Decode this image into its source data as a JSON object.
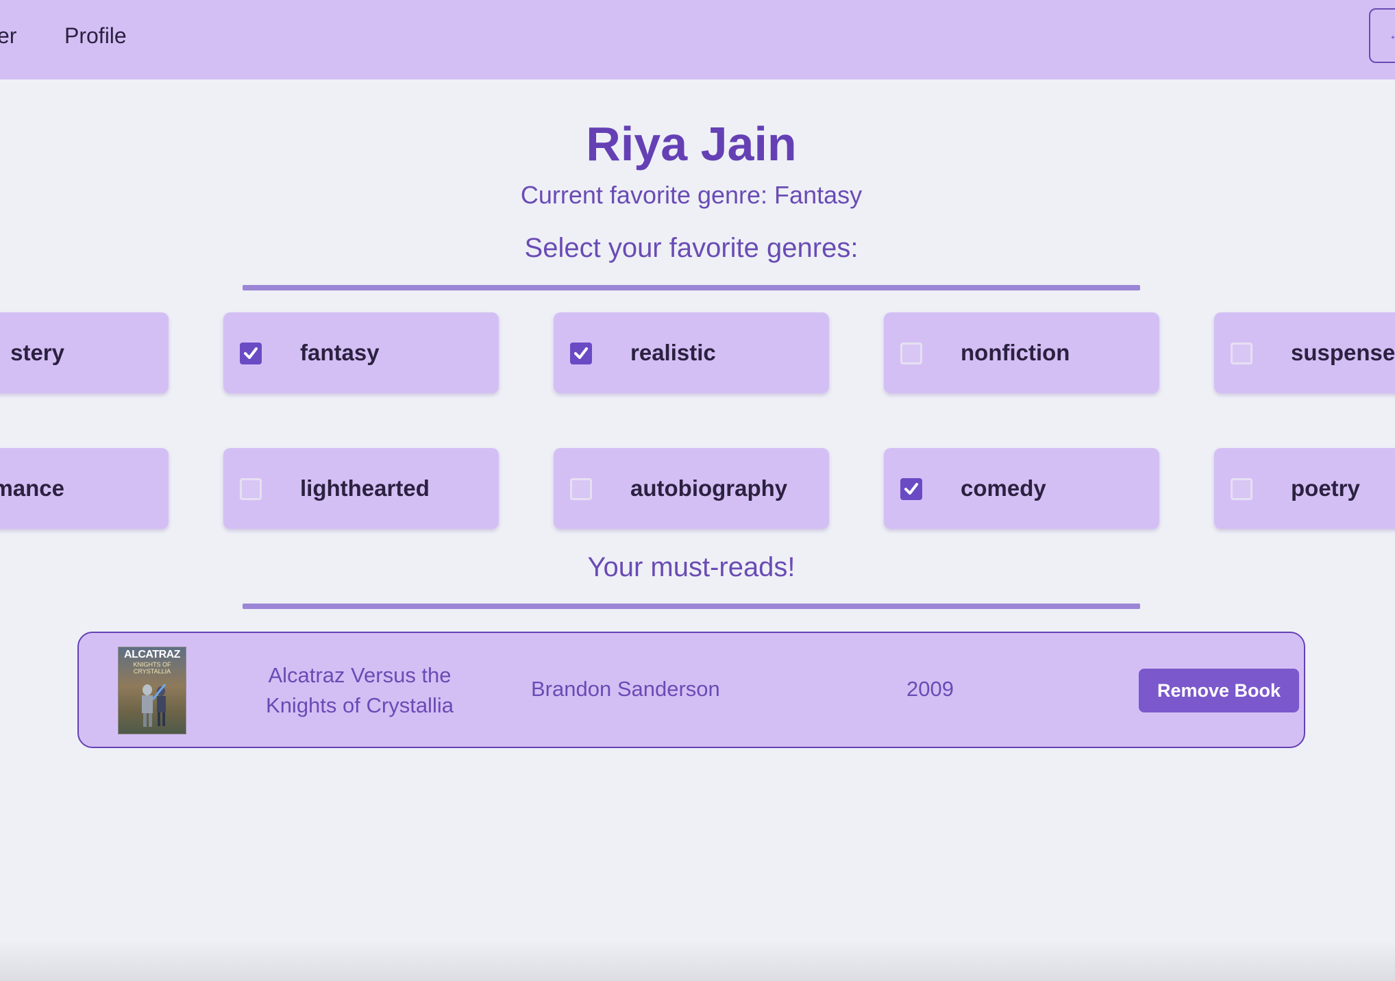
{
  "nav": {
    "links": [
      "er",
      "Profile"
    ],
    "logout_glyph": "←"
  },
  "profile": {
    "name": "Riya Jain",
    "current_genre": "Current favorite genre: Fantasy"
  },
  "genres": {
    "heading": "Select your favorite genres:",
    "items": [
      {
        "label": "stery",
        "checked": null
      },
      {
        "label": "fantasy",
        "checked": true
      },
      {
        "label": "realistic",
        "checked": true
      },
      {
        "label": "nonfiction",
        "checked": false
      },
      {
        "label": "suspense",
        "checked": false
      },
      {
        "label": "mance",
        "checked": null
      },
      {
        "label": "lighthearted",
        "checked": false
      },
      {
        "label": "autobiography",
        "checked": false
      },
      {
        "label": "comedy",
        "checked": true
      },
      {
        "label": "poetry",
        "checked": false
      }
    ]
  },
  "must_reads": {
    "heading": "Your must-reads!",
    "books": [
      {
        "cover_text": "ALCATRAZ",
        "cover_subtext": "KNIGHTS OF CRYSTALLIA",
        "title": "Alcatraz Versus the Knights of Crystallia",
        "author": "Brandon Sanderson",
        "year": "2009",
        "action_label": "Remove Book"
      }
    ]
  },
  "colors": {
    "navbar": "#d4bff5",
    "accent": "#6440b4",
    "button": "#7b58cc",
    "background": "#eef0f6"
  }
}
